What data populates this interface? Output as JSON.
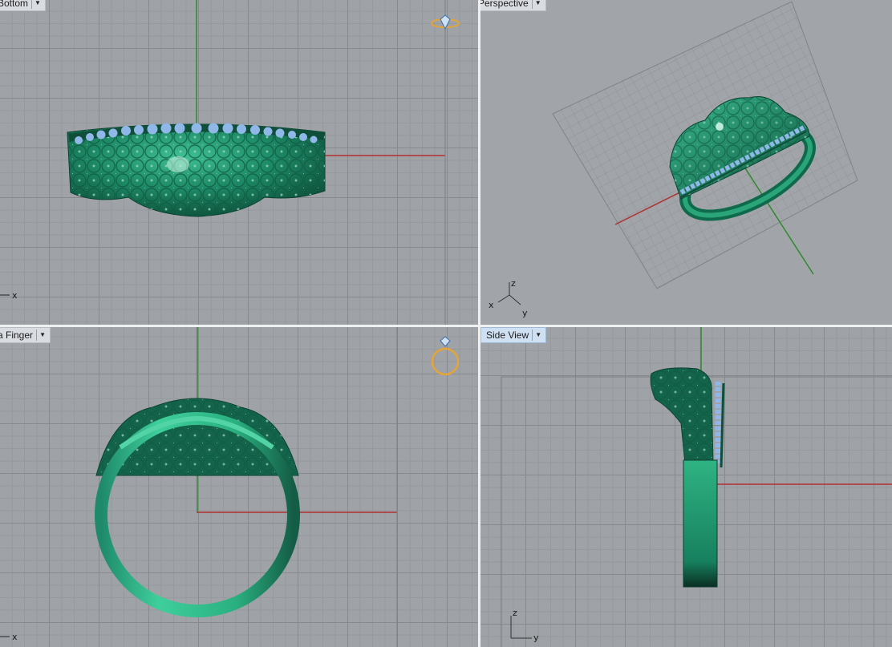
{
  "viewports": {
    "top": {
      "title": "Bottom",
      "active": false
    },
    "perspective": {
      "title": "Perspective",
      "active": false
    },
    "front": {
      "title": "a Finger",
      "active": false
    },
    "side": {
      "title": "Side View",
      "active": true
    }
  },
  "axis_labels": {
    "top_x": "x",
    "persp_x": "x",
    "persp_y": "y",
    "persp_z": "z",
    "front_x": "x",
    "side_z": "z",
    "side_y": "y"
  },
  "icons": {
    "top_corner": "ring-with-diamond-side-icon",
    "front_corner": "ring-with-diamond-front-icon",
    "tab_dropdown": "triangle-down-icon"
  },
  "colors": {
    "viewport_bg": "#9fa2a6",
    "grid_major": "#878b8f",
    "grid_minor": "#96999d",
    "axis_x": "#b03030",
    "axis_y": "#2e8a2e",
    "ring_metal": "#1f8a6a",
    "gems": "#8fb8e8",
    "icon_gold": "#e3a53a"
  }
}
